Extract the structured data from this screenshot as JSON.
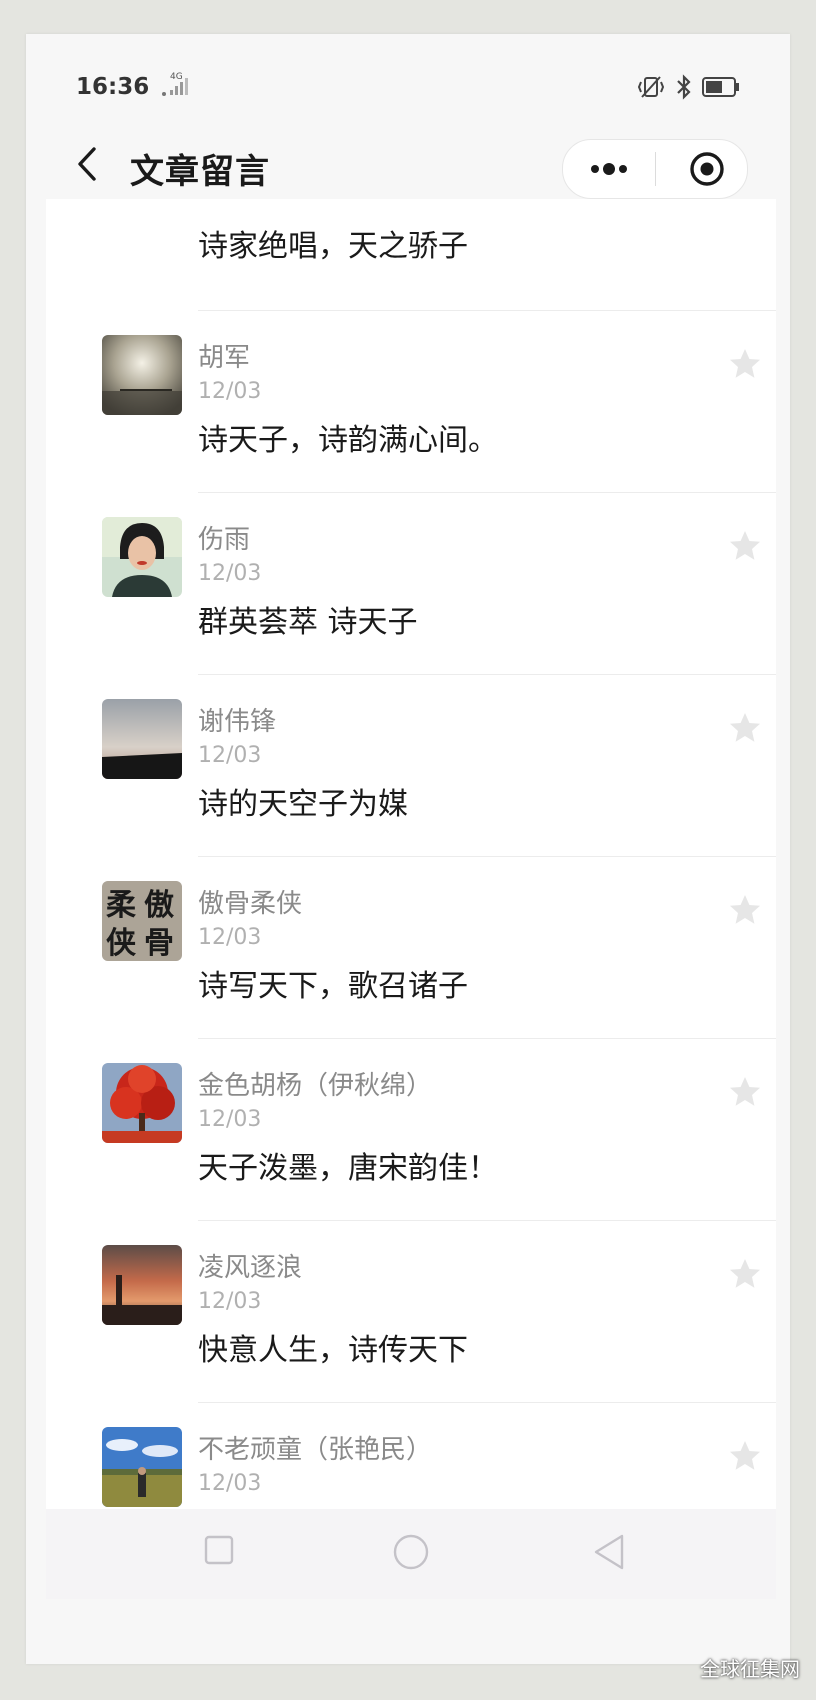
{
  "status_bar": {
    "time": "16:36",
    "network": "4G",
    "icons": [
      "signal-icon",
      "vibrate-icon",
      "bluetooth-icon",
      "battery-icon"
    ]
  },
  "header": {
    "title": "文章留言",
    "icons": [
      "back-icon",
      "more-icon",
      "target-icon"
    ]
  },
  "first_comment": {
    "content": "诗家绝唱，天之骄子"
  },
  "comments": [
    {
      "name": "胡军",
      "date": "12/03",
      "content": "诗天子，诗韵满心间。"
    },
    {
      "name": "伤雨",
      "date": "12/03",
      "content": "群英荟萃 诗天子"
    },
    {
      "name": "谢伟锋",
      "date": "12/03",
      "content": "诗的天空子为媒"
    },
    {
      "name": "傲骨柔侠",
      "date": "12/03",
      "content": "诗写天下，歌召诸子"
    },
    {
      "name": "金色胡杨（伊秋绵）",
      "date": "12/03",
      "content": "天子泼墨，唐宋韵佳！"
    },
    {
      "name": "凌风逐浪",
      "date": "12/03",
      "content": "快意人生，诗传天下"
    },
    {
      "name": "不老顽童（张艳民）",
      "date": "12/03",
      "content": ""
    }
  ],
  "avatar_text": {
    "aogu": [
      "柔",
      "傲",
      "侠",
      "骨"
    ]
  },
  "nav_bar": {
    "icons": [
      "recent-apps-icon",
      "home-icon",
      "nav-back-icon"
    ]
  },
  "watermark": "全球征集网",
  "colors": {
    "text_primary": "#1a1a1a",
    "text_secondary": "#8a8a8a",
    "text_date": "#b0b0b0",
    "star": "#e6e6e6",
    "divider": "#ececec"
  }
}
